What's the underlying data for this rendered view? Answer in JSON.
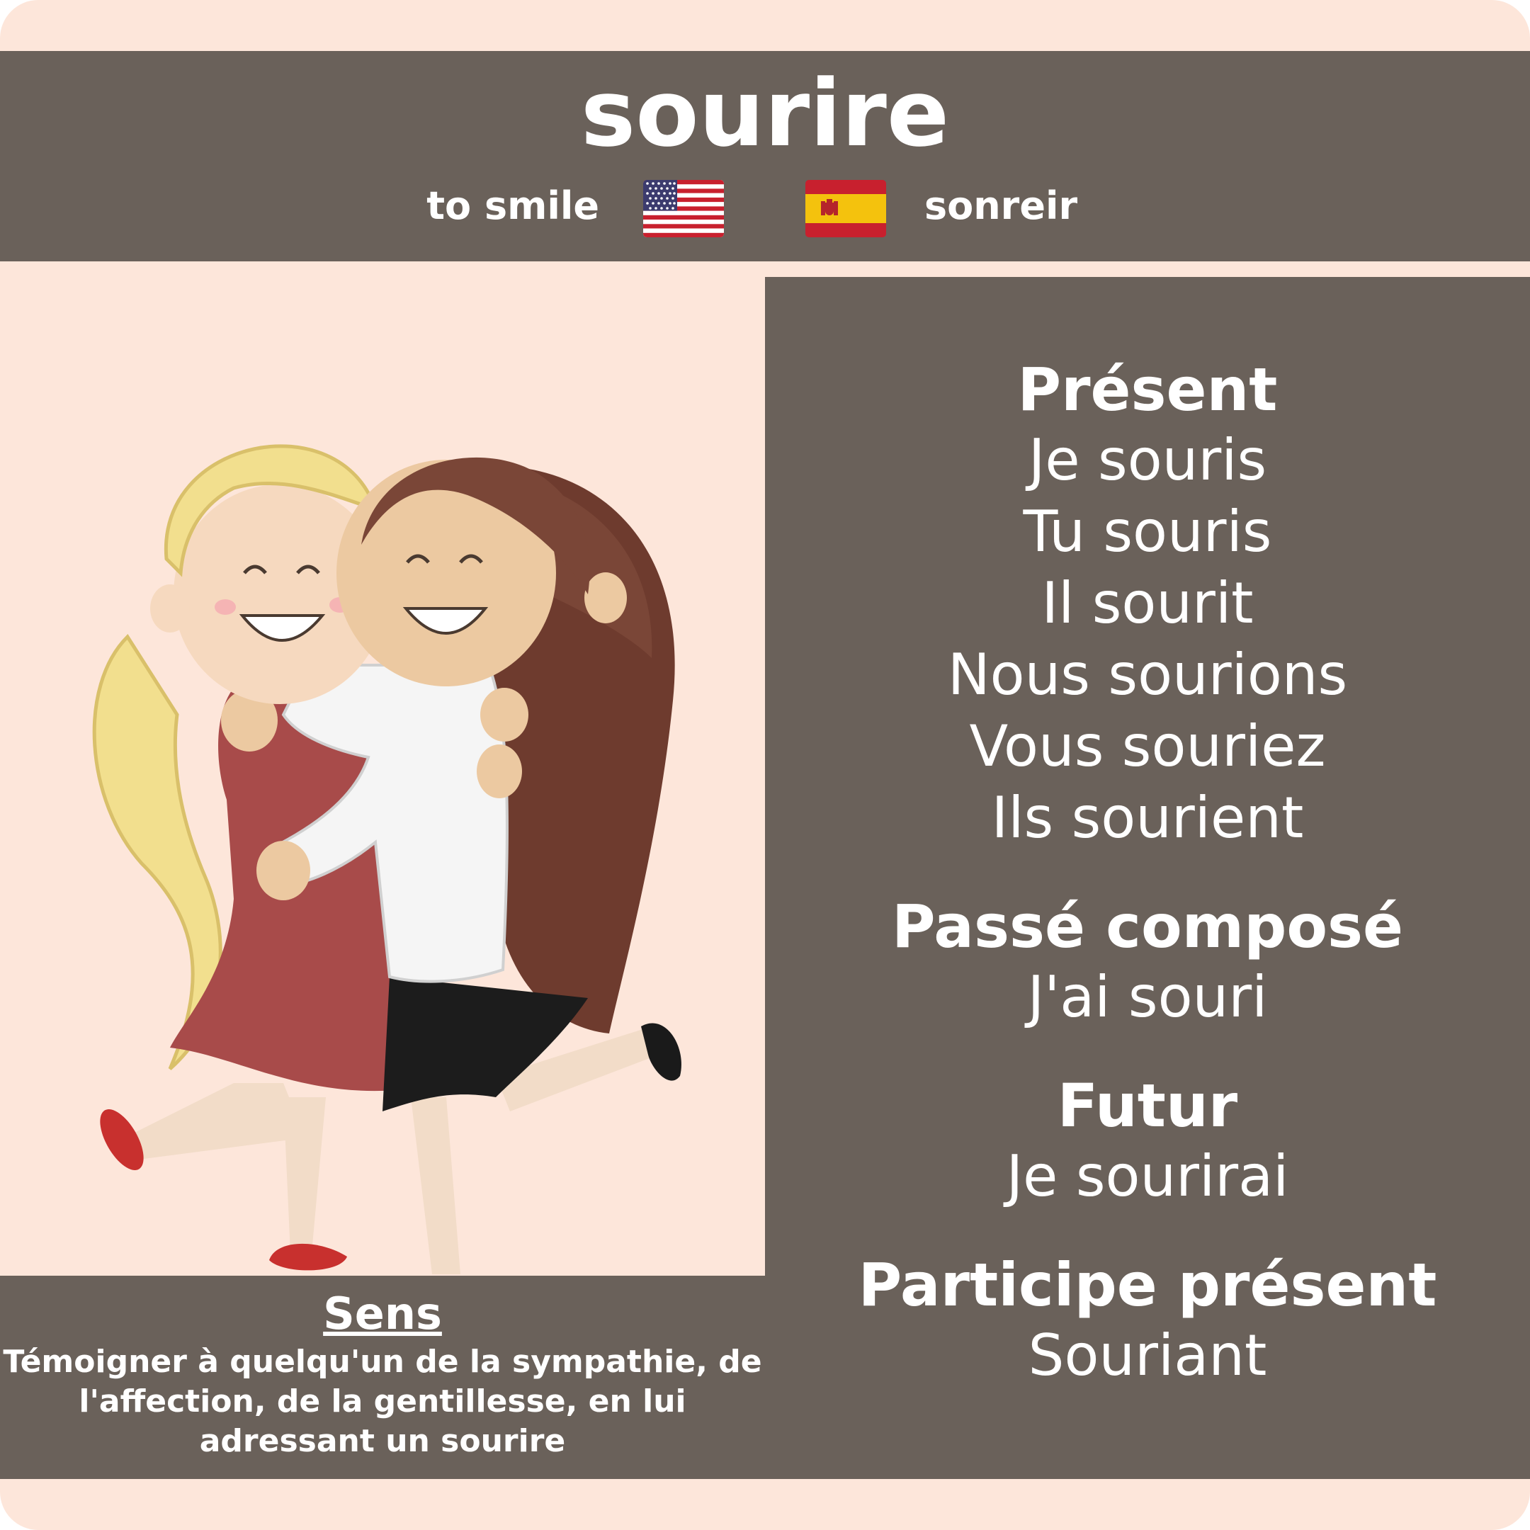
{
  "header": {
    "word": "sourire",
    "english": "to smile",
    "spanish": "sonreir",
    "flag_english": "us-flag-icon",
    "flag_spanish": "spain-flag-icon"
  },
  "illustration": "two-girls-hugging-illustration",
  "conjugation": {
    "present": {
      "title": "Présent",
      "forms": [
        "Je souris",
        "Tu souris",
        "Il sourit",
        "Nous sourions",
        "Vous souriez",
        "Ils sourient"
      ]
    },
    "passe_compose": {
      "title": "Passé composé",
      "forms": [
        "J'ai souri"
      ]
    },
    "futur": {
      "title": "Futur",
      "forms": [
        "Je sourirai"
      ]
    },
    "participe_present": {
      "title": "Participe présent",
      "forms": [
        "Souriant"
      ]
    }
  },
  "sens": {
    "title": "Sens",
    "text": "Témoigner à quelqu'un de la sympathie, de l'affection, de la gentillesse, en lui adressant un sourire"
  },
  "colors": {
    "background": "#fde6da",
    "panel": "#6a615a",
    "text": "#ffffff"
  }
}
